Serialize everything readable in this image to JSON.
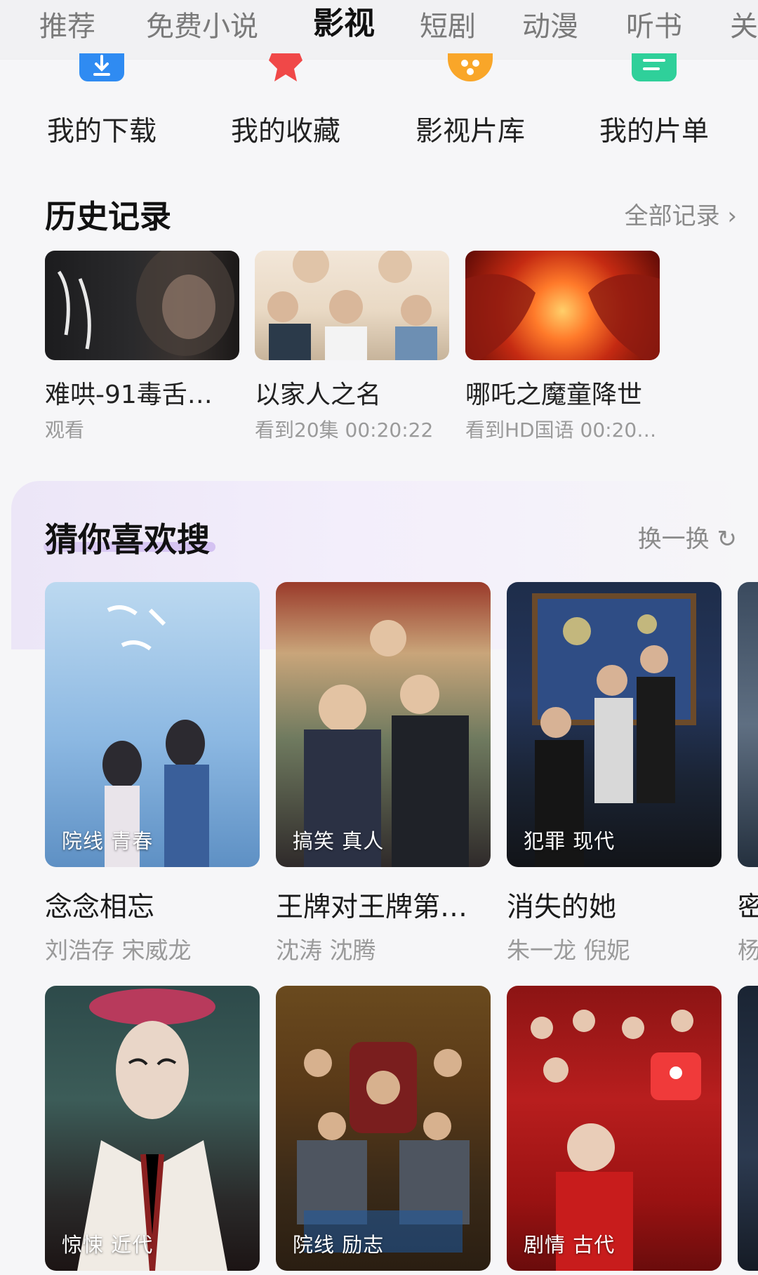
{
  "tabs": [
    {
      "label": "推荐"
    },
    {
      "label": "免费小说"
    },
    {
      "label": "影视",
      "active": true
    },
    {
      "label": "短剧"
    },
    {
      "label": "动漫"
    },
    {
      "label": "听书"
    },
    {
      "label": "关"
    }
  ],
  "quick_entries": [
    {
      "label": "我的下载",
      "icon": "download-icon",
      "color": "#2f8bf2"
    },
    {
      "label": "我的收藏",
      "icon": "star-icon",
      "color": "#f04848"
    },
    {
      "label": "影视片库",
      "icon": "film-icon",
      "color": "#f9a629"
    },
    {
      "label": "我的片单",
      "icon": "list-icon",
      "color": "#2fd09a"
    }
  ],
  "history": {
    "title": "历史记录",
    "all_label": "全部记录 ›",
    "items": [
      {
        "title": "难哄-91毒舌…",
        "sub": "观看"
      },
      {
        "title": "以家人之名",
        "sub": "看到20集 00:20:22"
      },
      {
        "title": "哪吒之魔童降世",
        "sub": "看到HD国语 00:20…"
      }
    ]
  },
  "recommend": {
    "title": "猜你喜欢搜",
    "refresh_label": "换一换",
    "items": [
      {
        "tags": "院线 青春",
        "title": "念念相忘",
        "cast": "刘浩存 宋威龙"
      },
      {
        "tags": "搞笑 真人",
        "title": "王牌对王牌第…",
        "cast": "沈涛 沈腾"
      },
      {
        "tags": "犯罪 现代",
        "title": "消失的她",
        "cast": "朱一龙 倪妮"
      },
      {
        "tags": "",
        "title": "密",
        "cast": "杨"
      },
      {
        "tags": "惊悚 近代",
        "title": "",
        "cast": ""
      },
      {
        "tags": "院线 励志",
        "title": "",
        "cast": ""
      },
      {
        "tags": "剧情 古代",
        "title": "",
        "cast": ""
      }
    ]
  }
}
